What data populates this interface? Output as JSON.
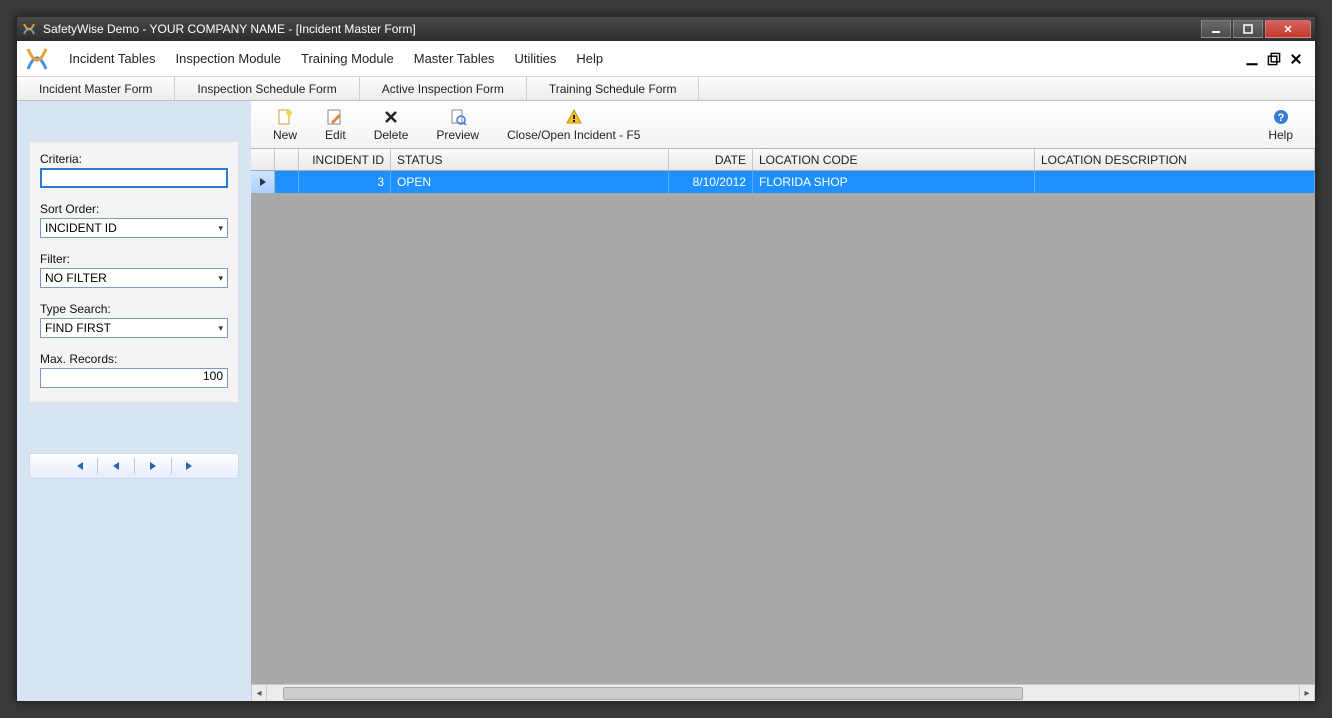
{
  "window": {
    "title": "SafetyWise Demo - YOUR COMPANY NAME - [Incident Master Form]"
  },
  "menu": {
    "items": [
      "Incident Tables",
      "Inspection Module",
      "Training Module",
      "Master Tables",
      "Utilities",
      "Help"
    ]
  },
  "subtabs": [
    "Incident Master Form",
    "Inspection Schedule Form",
    "Active Inspection Form",
    "Training Schedule Form"
  ],
  "toolbar": {
    "new": "New",
    "edit": "Edit",
    "delete": "Delete",
    "preview": "Preview",
    "closeopen": "Close/Open Incident - F5",
    "help": "Help"
  },
  "sidebar": {
    "criteria_label": "Criteria:",
    "criteria_value": "",
    "sort_label": "Sort Order:",
    "sort_value": "INCIDENT ID",
    "filter_label": "Filter:",
    "filter_value": "NO FILTER",
    "typesearch_label": "Type Search:",
    "typesearch_value": "FIND FIRST",
    "max_label": "Max. Records:",
    "max_value": "100"
  },
  "grid": {
    "headers": {
      "id": "INCIDENT ID",
      "status": "STATUS",
      "date": "DATE",
      "loc": "LOCATION CODE",
      "desc": "LOCATION DESCRIPTION"
    },
    "rows": [
      {
        "id": "3",
        "status": "OPEN",
        "date": "8/10/2012",
        "loc": "FLORIDA SHOP",
        "desc": ""
      }
    ]
  }
}
